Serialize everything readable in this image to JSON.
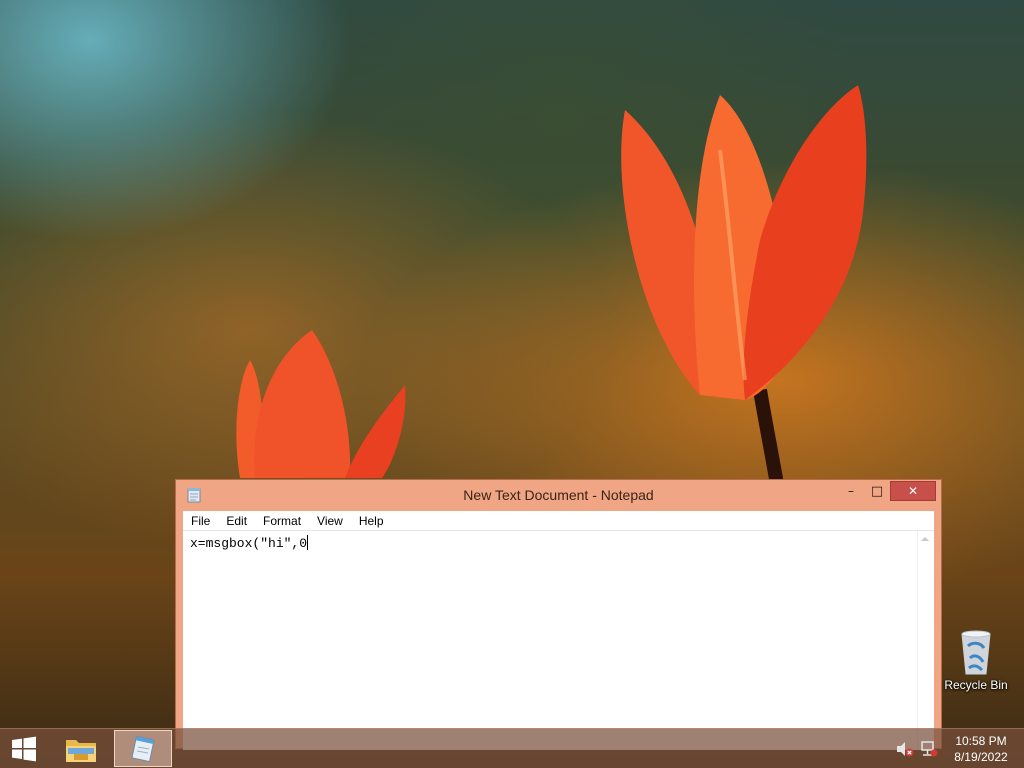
{
  "desktop": {
    "icons": [
      {
        "label": "Recycle Bin",
        "icon": "recycle-bin-icon"
      }
    ]
  },
  "window": {
    "title": "New Text Document - Notepad",
    "app_icon": "notepad-icon",
    "controls": {
      "minimize": "–",
      "maximize": "□",
      "close": "✕"
    },
    "menu": [
      "File",
      "Edit",
      "Format",
      "View",
      "Help"
    ],
    "content": "x=msgbox(\"hi\",0"
  },
  "taskbar": {
    "start_icon": "windows-logo-icon",
    "pinned": [
      {
        "name": "File Explorer",
        "icon": "folder-icon"
      },
      {
        "name": "Notepad",
        "icon": "notepad-icon",
        "active": true
      }
    ],
    "tray": {
      "volume": "volume-muted-icon",
      "network": "network-error-icon"
    },
    "clock": {
      "time": "10:58 PM",
      "date": "8/19/2022"
    }
  },
  "colors": {
    "window_frame": "#f0a585",
    "close_button": "#c7504a",
    "taskbar": "#78503c"
  }
}
